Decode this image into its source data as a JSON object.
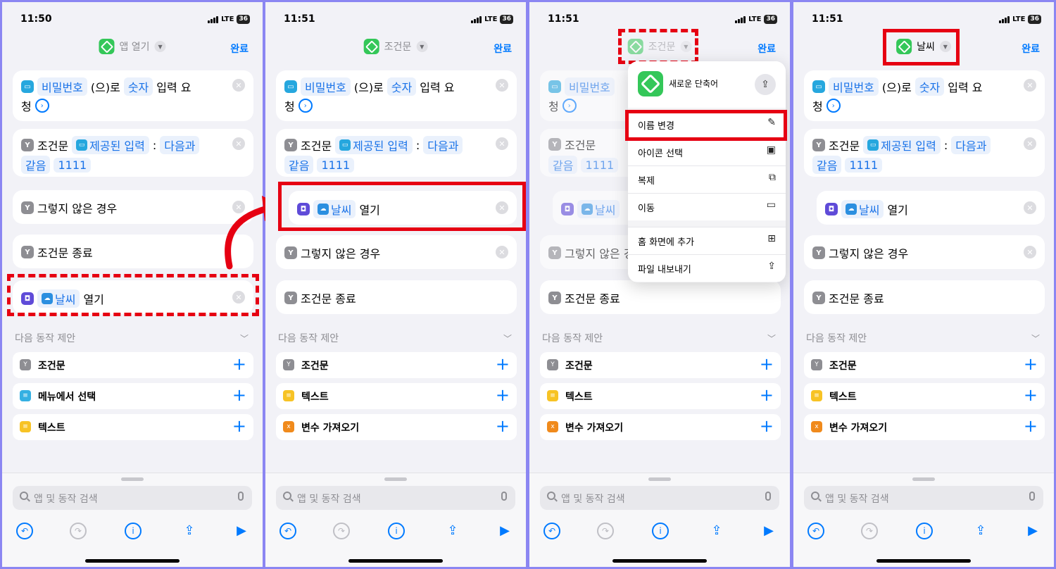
{
  "status": {
    "p1_time": "11:50",
    "time": "11:51",
    "network": "LTE",
    "battery": "36"
  },
  "nav": {
    "title_app_open": "앱 열기",
    "title_if": "조건문",
    "title_weather": "날씨",
    "done": "완료"
  },
  "actions": {
    "ask_chip": "비밀번호",
    "ask_mid": "(으)로",
    "ask_num": "숫자",
    "ask_tail": "입력 요",
    "ask_line2": "청",
    "if_label": "조건문",
    "if_input": "제공된 입력",
    "if_colon": ":",
    "if_cond": "다음과",
    "if_cond2": "같음",
    "if_value": "1111",
    "otherwise": "그렇지 않은 경우",
    "end_if": "조건문 종료",
    "open_app": "날씨",
    "open_verb": "열기"
  },
  "suggestions": {
    "header": "다음 동작 제안",
    "p1": [
      "조건문",
      "메뉴에서 선택",
      "텍스트"
    ],
    "p2": [
      "조건문",
      "텍스트",
      "변수 가져오기"
    ]
  },
  "search": {
    "placeholder": "앱 및 동작 검색"
  },
  "menu": {
    "title": "새로운 단축어",
    "items": [
      "이름 변경",
      "아이콘 선택",
      "복제",
      "이동",
      "홈 화면에 추가",
      "파일 내보내기"
    ]
  },
  "colors": {
    "accent": "#007aff",
    "highlight": "#e60012",
    "shortcut_green": "#34c759"
  }
}
